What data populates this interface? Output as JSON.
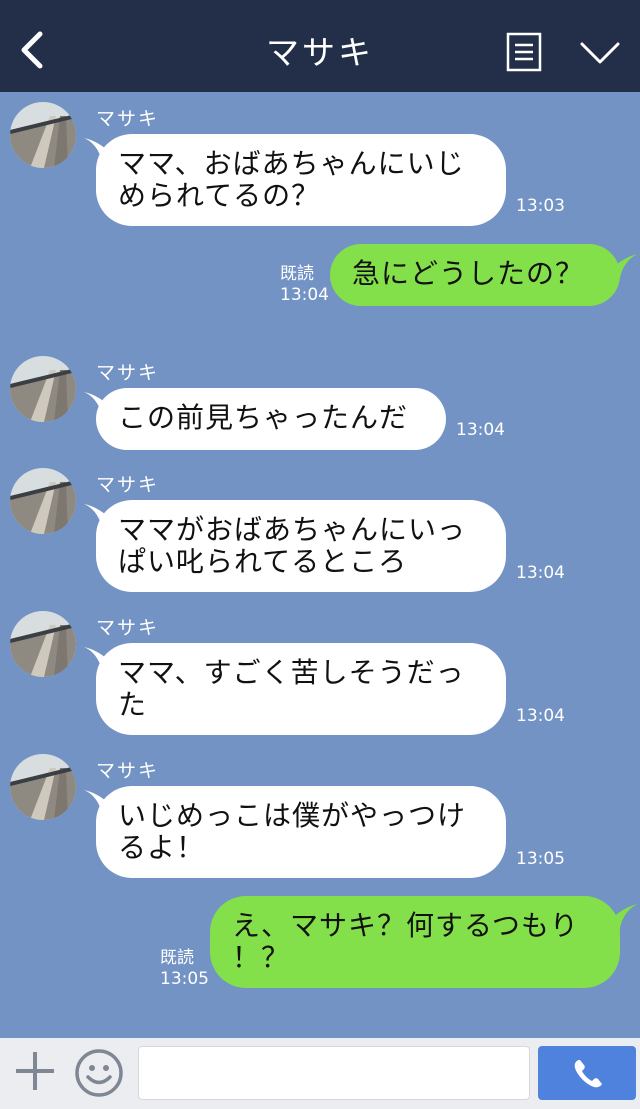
{
  "header": {
    "title": "マサキ",
    "back_icon": "chevron-left-icon",
    "menu_icon": "document-menu-icon",
    "collapse_icon": "chevron-down-icon"
  },
  "messages": [
    {
      "dir": "in",
      "sender": "マサキ",
      "lines": [
        "ママ、おばあちゃんにいじ",
        "められてるの？"
      ],
      "time": "13:03"
    },
    {
      "dir": "out",
      "read": "既読",
      "lines": [
        "急にどうしたの？"
      ],
      "time": "13:04"
    },
    {
      "dir": "in",
      "sender": "マサキ",
      "lines": [
        "この前見ちゃったんだ"
      ],
      "time": "13:04"
    },
    {
      "dir": "in",
      "sender": "マサキ",
      "lines": [
        "ママがおばあちゃんにいっ",
        "ぱい叱られてるところ"
      ],
      "time": "13:04"
    },
    {
      "dir": "in",
      "sender": "マサキ",
      "lines": [
        "ママ、すごく苦しそうだっ",
        "た"
      ],
      "time": "13:04"
    },
    {
      "dir": "in",
      "sender": "マサキ",
      "lines": [
        "いじめっこは僕がやっつけ",
        "るよ！"
      ],
      "time": "13:05"
    },
    {
      "dir": "out",
      "read": "既読",
      "lines": [
        "え、マサキ？何するつもり",
        "！？"
      ],
      "time": "13:05"
    }
  ],
  "footer": {
    "input_value": "",
    "add_icon": "plus-icon",
    "emoji_icon": "smiley-icon",
    "call_icon": "phone-icon"
  },
  "colors": {
    "header_bg": "#232f48",
    "chat_bg": "#7393c4",
    "incoming_bubble": "#ffffff",
    "outgoing_bubble": "#84e04a",
    "call_button": "#4f82dc"
  }
}
